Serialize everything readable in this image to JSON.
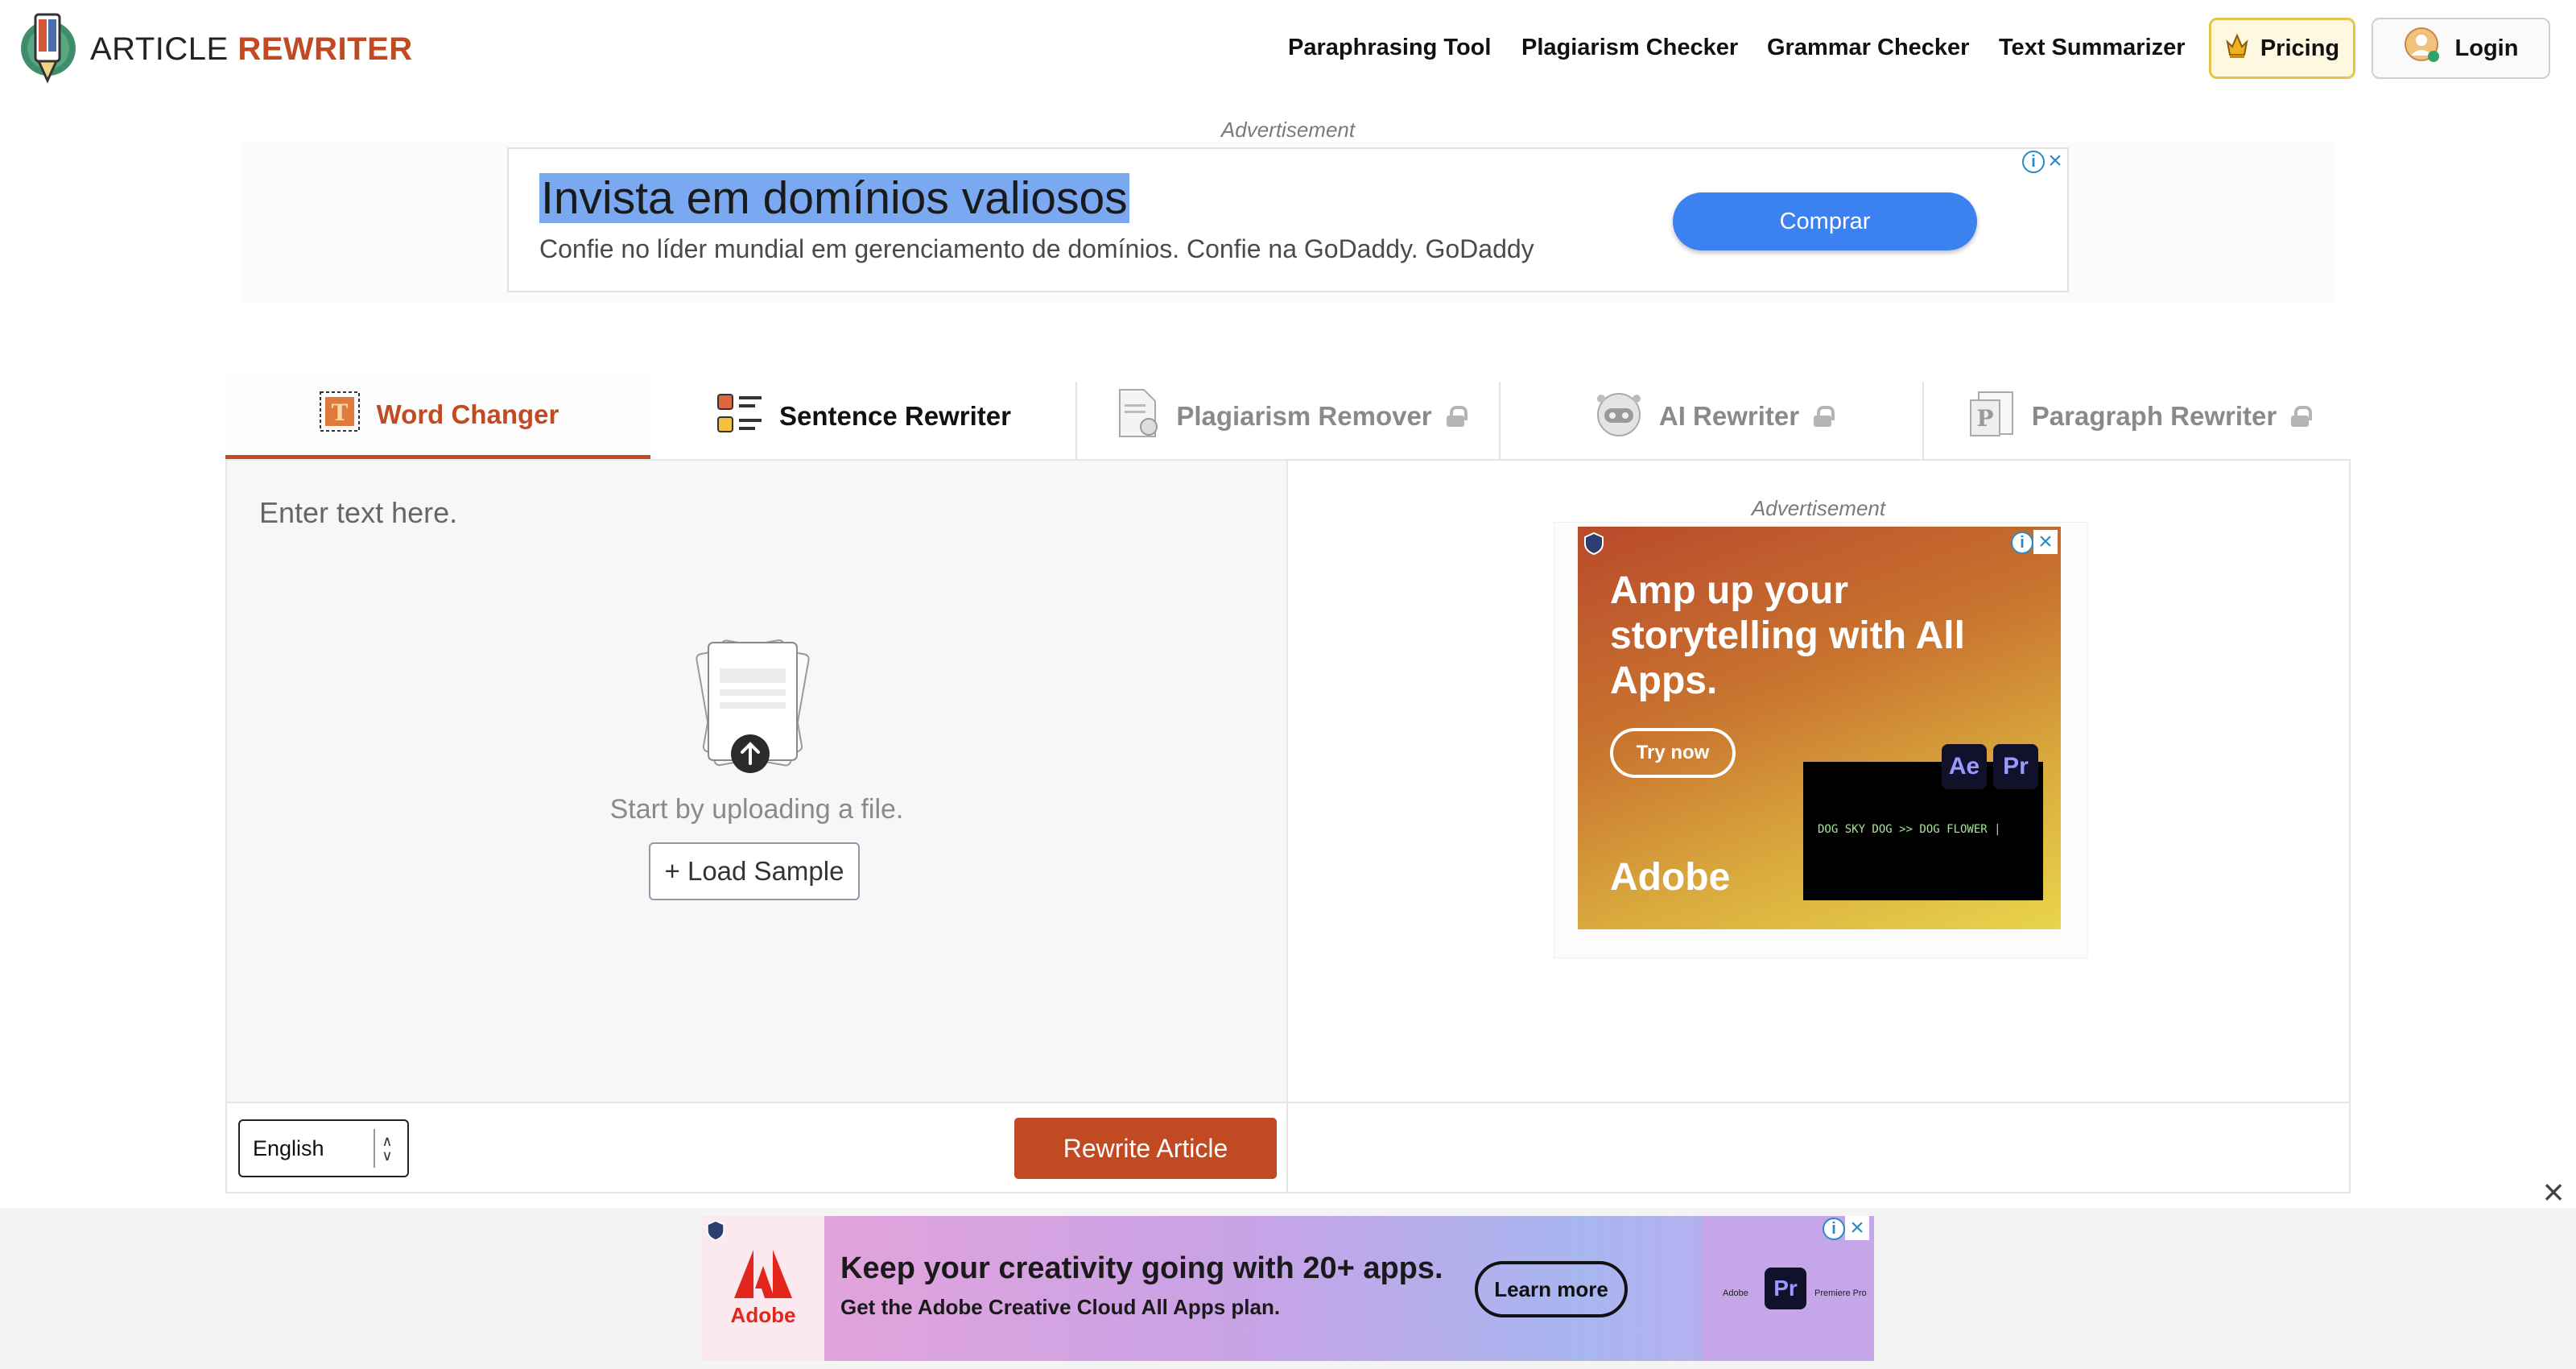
{
  "header": {
    "logo": {
      "word1": "ARTICLE",
      "word2": "REWRITER"
    },
    "nav": [
      "Paraphrasing Tool",
      "Plagiarism Checker",
      "Grammar Checker",
      "Text Summarizer"
    ],
    "pricing_label": "Pricing",
    "login_label": "Login"
  },
  "top_ad": {
    "label": "Advertisement",
    "headline": "Invista em domínios valiosos",
    "subtext": "Confie no líder mundial em gerenciamento de domínios. Confie na GoDaddy. GoDaddy",
    "cta": "Comprar"
  },
  "tabs": [
    {
      "label": "Word Changer",
      "state": "active",
      "icon": "word-changer-icon"
    },
    {
      "label": "Sentence Rewriter",
      "state": "normal",
      "icon": "sentence-list-icon"
    },
    {
      "label": "Plagiarism Remover",
      "state": "locked",
      "icon": "document-icon"
    },
    {
      "label": "AI Rewriter",
      "state": "locked",
      "icon": "robot-icon"
    },
    {
      "label": "Paragraph Rewriter",
      "state": "locked",
      "icon": "paragraph-icon"
    }
  ],
  "editor": {
    "placeholder": "Enter text here.",
    "upload_text": "Start by uploading a file.",
    "load_sample": "+ Load Sample",
    "language": "English",
    "rewrite_button": "Rewrite Article"
  },
  "side_ad": {
    "label": "Advertisement",
    "headline": "Amp up your storytelling with All Apps.",
    "cta": "Try now",
    "brand": "Adobe",
    "video_text": "DOG SKY DOG >> DOG FLOWER |",
    "badges": [
      "Ae",
      "Pr"
    ]
  },
  "bottom_ad": {
    "headline": "Keep your creativity going with 20+ apps.",
    "subtext": "Get the Adobe Creative Cloud All Apps plan.",
    "cta": "Learn more",
    "brand": "Adobe",
    "badge": "Pr",
    "thumb_brand": "Adobe",
    "thumb_app": "Premiere Pro"
  },
  "colors": {
    "brand_accent": "#c14a22",
    "ad_button_blue": "#3b82f0",
    "pricing_gold": "#e6c24a"
  }
}
